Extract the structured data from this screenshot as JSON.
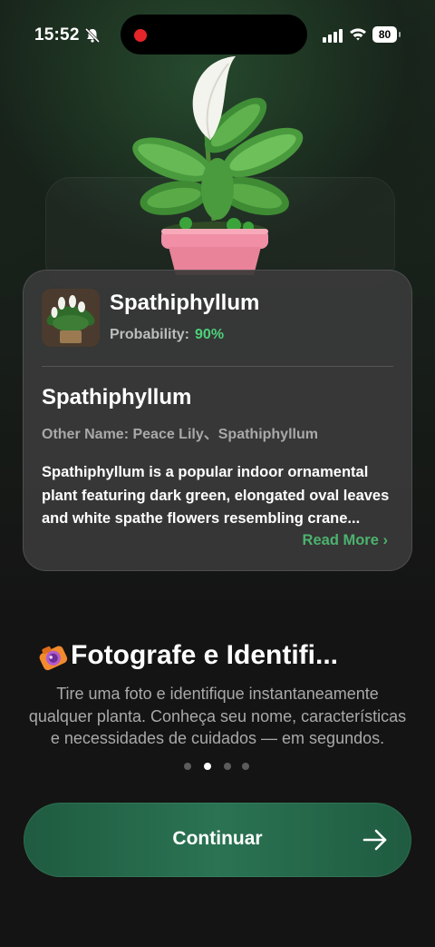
{
  "status_bar": {
    "time": "15:52",
    "battery": "80",
    "icons": [
      "bell-muted-icon",
      "recording-dot-icon",
      "signal-icon",
      "wifi-icon",
      "battery-icon"
    ]
  },
  "result_card": {
    "plant_name": "Spathiphyllum",
    "probability_label": "Probability:",
    "probability_value": "90%",
    "scientific_name": "Spathiphyllum",
    "other_name": "Other Name: Peace Lily、Spathiphyllum",
    "description": " Spathiphyllum is a popular indoor ornamental plant featuring dark green, elongated oval leaves and white spathe flowers resembling crane...",
    "read_more": "Read More"
  },
  "onboarding": {
    "headline": "Fotografe e Identifi...",
    "subtitle": "Tire uma foto e identifique instantaneamente qualquer planta. Conheça seu nome, características e necessidades de cuidados — em segundos.",
    "page_count": 4,
    "active_page": 2
  },
  "cta": {
    "label": "Continuar",
    "icon": "arrow-right-icon"
  },
  "colors": {
    "accent_green": "#4cd07a",
    "read_more_green": "#4cb26e",
    "button_green": "#2a7353",
    "background": "#141414"
  }
}
